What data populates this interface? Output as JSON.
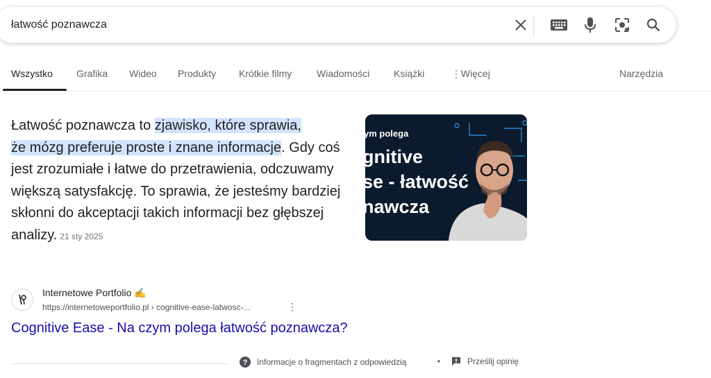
{
  "search": {
    "query": "łatwość poznawcza"
  },
  "tabs": [
    {
      "label": "Wszystko"
    },
    {
      "label": "Grafika"
    },
    {
      "label": "Wideo"
    },
    {
      "label": "Produkty"
    },
    {
      "label": "Krótkie filmy"
    },
    {
      "label": "Wiadomości"
    },
    {
      "label": "Książki"
    },
    {
      "label": "Więcej"
    },
    {
      "label": "Narzędzia"
    }
  ],
  "snippet": {
    "part1": "Łatwość poznawcza to ",
    "highlight_line1": "zjawisko, które sprawia,",
    "highlight_line2": "że mózg preferuje proste i znane informacje",
    "part2": ". Gdy coś jest zrozumiałe i łatwe do przetrawienia, odczuwamy większą satysfakcję. To sprawia, że jesteśmy bardziej skłonni do akceptacji takich informacji bez głębszej analizy.",
    "date": "21 sty 2025"
  },
  "thumbnail": {
    "line0": "ym polega",
    "line1": "gnitive",
    "line2": "se - łatwość",
    "line3": "nawcza",
    "bg": "#0c1a2e",
    "accent": "#2ea3f2"
  },
  "source": {
    "name": "Internetowe Portfolio",
    "emoji": "✍️",
    "url": "https://internetoweportfolio.pl › cognitive-ease-latwosc-..."
  },
  "result": {
    "title": "Cognitive Ease - Na czym polega łatwość poznawcza?"
  },
  "footer": {
    "about": "Informacje o fragmentach z odpowiedzią",
    "feedback": "Prześlij opinię"
  },
  "colors": {
    "link": "#1a0dab",
    "highlight": "#d3e3fd",
    "muted": "#5f6368"
  }
}
